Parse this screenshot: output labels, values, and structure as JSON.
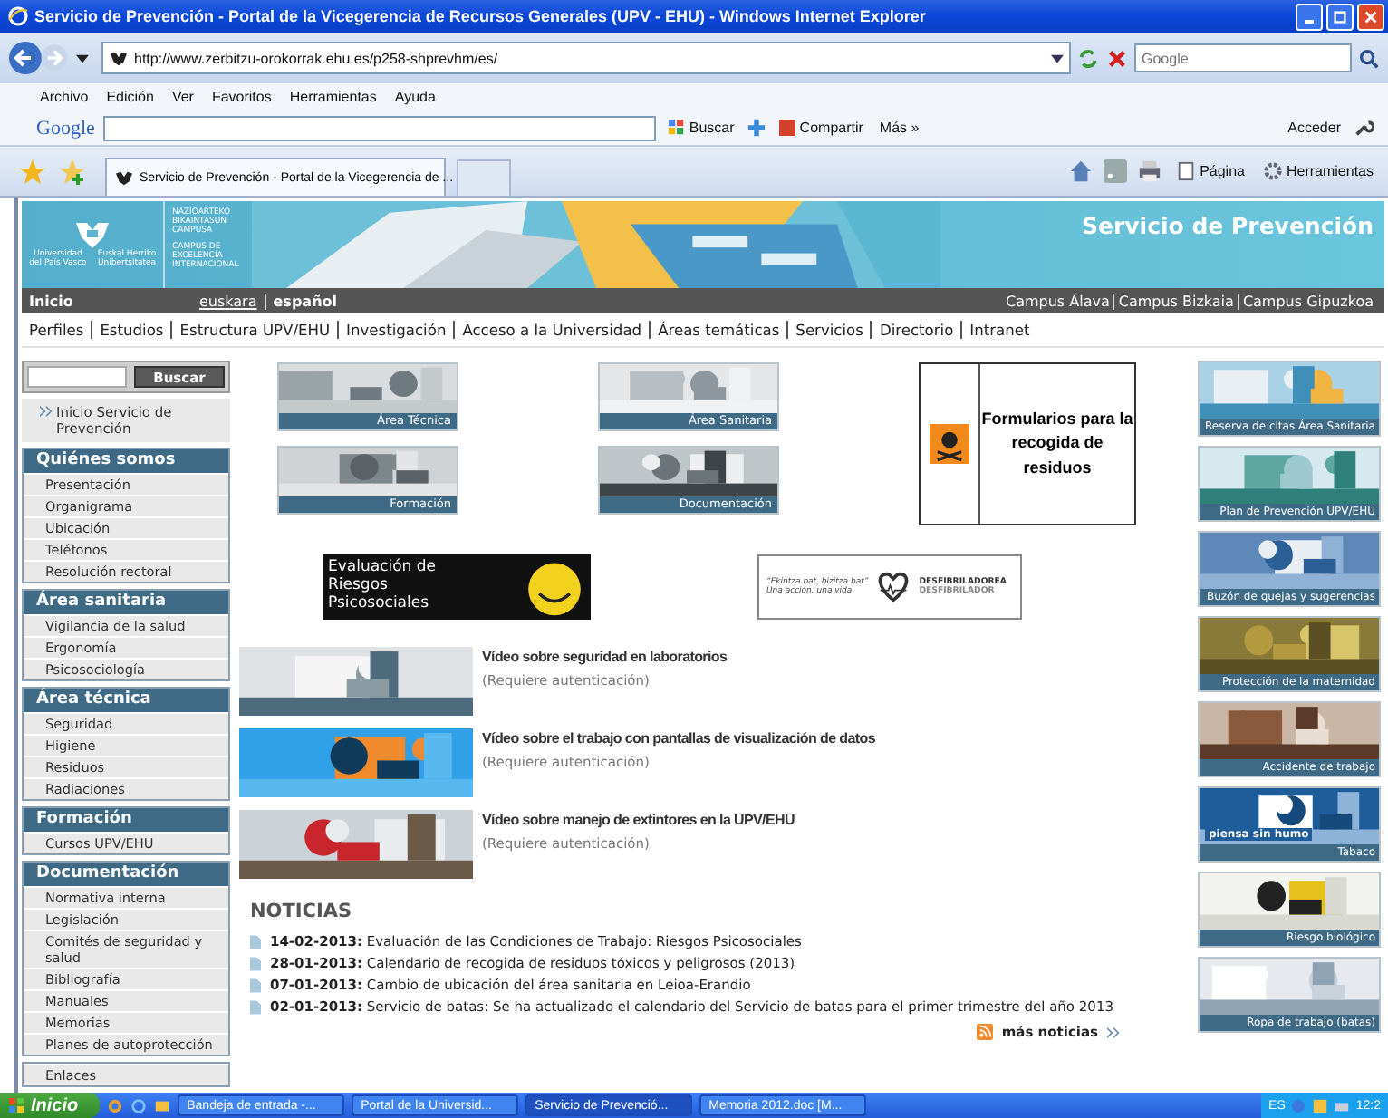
{
  "browser": {
    "title": "Servicio de Prevención - Portal de la Vicegerencia de Recursos Generales (UPV - EHU) - Windows Internet Explorer",
    "address": "http://www.zerbitzu-orokorrak.ehu.es/p258-shprevhm/es/",
    "search_placeholder": "Google",
    "menu": [
      "Archivo",
      "Edición",
      "Ver",
      "Favoritos",
      "Herramientas",
      "Ayuda"
    ],
    "google_toolbar": {
      "logo": "Google",
      "search": "Buscar",
      "share": "Compartir",
      "more": "Más »",
      "sign_in": "Acceder"
    },
    "tab": {
      "title": "Servicio de Prevención - Portal de la Vicegerencia de ..."
    },
    "command_bar": [
      "Página",
      "Herramientas"
    ]
  },
  "banner": {
    "university_names": [
      "Universidad del País Vasco",
      "Euskal Herriko Unibertsitatea"
    ],
    "campus_lines": [
      "NAZIOARTEKO BIKAINTASUN CAMPUSA",
      "CAMPUS DE EXCELENCIA INTERNACIONAL"
    ],
    "site_title": "Servicio de Prevención"
  },
  "top_nav": {
    "home": "Inicio",
    "languages": [
      {
        "label": "euskara",
        "selected": false
      },
      {
        "label": "español",
        "selected": true
      }
    ],
    "campuses": [
      "Campus Álava",
      "Campus Bizkaia",
      "Campus Gipuzkoa"
    ]
  },
  "main_nav": [
    "Perfiles",
    "Estudios",
    "Estructura UPV/EHU",
    "Investigación",
    "Acceso a la Universidad",
    "Áreas temáticas",
    "Servicios",
    "Directorio",
    "Intranet"
  ],
  "sidebar": {
    "search_button": "Buscar",
    "home_link": "Inicio Servicio de Prevención",
    "sections": [
      {
        "title": "Quiénes somos",
        "items": [
          "Presentación",
          "Organigrama",
          "Ubicación",
          "Teléfonos",
          "Resolución rectoral"
        ]
      },
      {
        "title": "Área sanitaria",
        "items": [
          "Vigilancia de la salud",
          "Ergonomía",
          "Psicosociología"
        ]
      },
      {
        "title": "Área técnica",
        "items": [
          "Seguridad",
          "Higiene",
          "Residuos",
          "Radiaciones"
        ]
      },
      {
        "title": "Formación",
        "items": [
          "Cursos UPV/EHU"
        ]
      },
      {
        "title": "Documentación",
        "items": [
          "Normativa interna",
          "Legislación",
          "Comités de seguridad y salud",
          "Bibliografía",
          "Manuales",
          "Memorias",
          "Planes de autoprotección"
        ]
      }
    ],
    "links": "Enlaces"
  },
  "tiles": [
    {
      "caption": "Área Técnica"
    },
    {
      "caption": "Área Sanitaria"
    },
    {
      "caption": "Formación"
    },
    {
      "caption": "Documentación"
    }
  ],
  "forms_banner": "Formularios para la recogida de residuos",
  "psychosocial_banner": "Evaluación de Riesgos Psicosociales",
  "defibrillator_banner": {
    "quote": "“Ekintza bat, bizitza bat”",
    "subquote": "Una acción, una vida",
    "title": "DESFIBRILADOREA",
    "subtitle": "DESFIBRILADOR"
  },
  "videos": [
    {
      "title": "Vídeo sobre seguridad en laboratorios",
      "note": "(Requiere autenticación)"
    },
    {
      "title": "Vídeo sobre el trabajo con pantallas de visualización de datos",
      "note": "(Requiere autenticación)"
    },
    {
      "title": "Vídeo sobre manejo de extintores en la UPV/EHU",
      "note": "(Requiere autenticación)"
    }
  ],
  "news": {
    "title": "NOTICIAS",
    "items": [
      {
        "date": "14-02-2013:",
        "text": "Evaluación de las Condiciones de Trabajo: Riesgos Psicosociales"
      },
      {
        "date": "28-01-2013:",
        "text": "Calendario de recogida de residuos tóxicos y peligrosos (2013)"
      },
      {
        "date": "07-01-2013:",
        "text": "Cambio de ubicación del área sanitaria en Leioa-Erandio"
      },
      {
        "date": "02-01-2013:",
        "text": "Servicio de batas: Se ha actualizado el calendario del Servicio de batas para el primer trimestre del año 2013"
      }
    ],
    "more": "más noticias"
  },
  "side_tiles": [
    {
      "caption": "Reserva de citas Área Sanitaria"
    },
    {
      "caption": "Plan de Prevención UPV/EHU"
    },
    {
      "caption": "Buzón de quejas y sugerencias"
    },
    {
      "caption": "Protección de la maternidad"
    },
    {
      "caption": "Accidente de trabajo"
    },
    {
      "caption": "Tabaco",
      "overlay": "piensa sin humo"
    },
    {
      "caption": "Riesgo biológico"
    },
    {
      "caption": "Ropa de trabajo (batas)"
    }
  ],
  "taskbar": {
    "start": "Inicio",
    "tasks": [
      {
        "label": "Bandeja de entrada -...",
        "selected": false
      },
      {
        "label": "Portal de la Universid...",
        "selected": false
      },
      {
        "label": "Servicio de Prevenció...",
        "selected": true
      },
      {
        "label": "Memoria 2012.doc [M...",
        "selected": false
      }
    ],
    "language": "ES",
    "clock": "12:2"
  }
}
